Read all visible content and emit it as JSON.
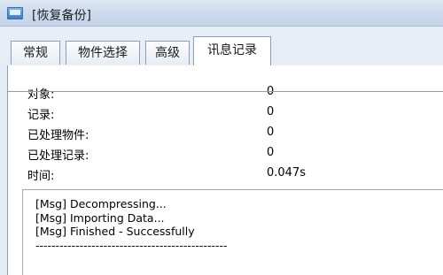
{
  "window": {
    "title": "[恢复备份]",
    "icon": "app-window-icon"
  },
  "tabs": [
    {
      "label": "常规",
      "active": false
    },
    {
      "label": "物件选择",
      "active": false
    },
    {
      "label": "高级",
      "active": false
    },
    {
      "label": "讯息记录",
      "active": true
    }
  ],
  "stats": [
    {
      "label": "对象:",
      "value": "0"
    },
    {
      "label": "记录:",
      "value": "0"
    },
    {
      "label": "已处理物件:",
      "value": "0"
    },
    {
      "label": "已处理记录:",
      "value": "0"
    },
    {
      "label": "时间:",
      "value": "0.047s"
    }
  ],
  "log": {
    "lines": [
      "[Msg] Decompressing...",
      "[Msg] Importing Data...",
      "[Msg] Finished - Successfully",
      "------------------------------------------------"
    ]
  }
}
